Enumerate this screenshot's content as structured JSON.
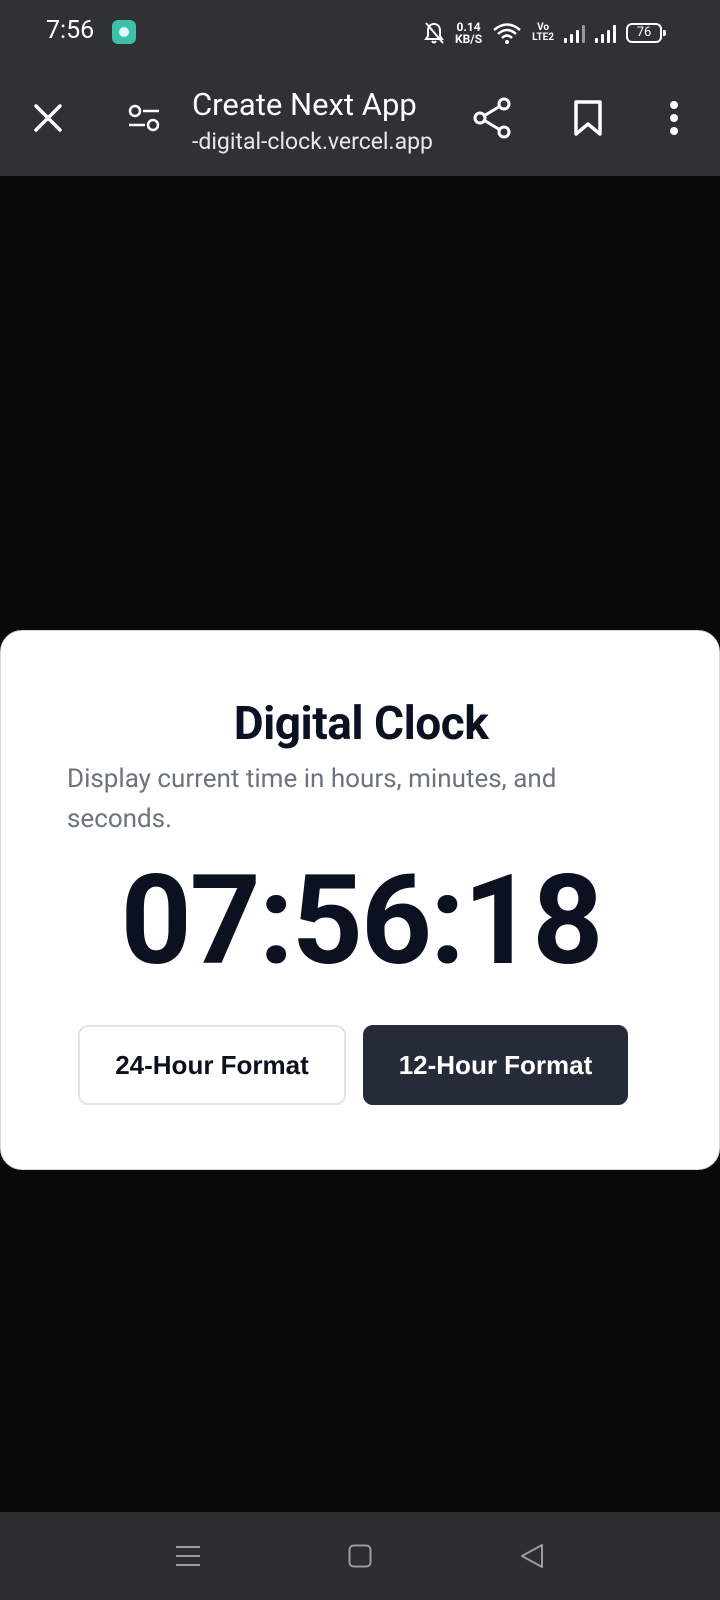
{
  "status_bar": {
    "time": "7:56",
    "net_speed_value": "0.14",
    "net_speed_unit": "KB/S",
    "volte_top": "Vo",
    "volte_bottom": "LTE2",
    "battery": "76"
  },
  "toolbar": {
    "page_title": "Create Next App",
    "url": "-digital-clock.vercel.app"
  },
  "card": {
    "title": "Digital Clock",
    "description": "Display current time in hours, minutes, and seconds.",
    "time": "07:56:18",
    "button_24h": "24-Hour Format",
    "button_12h": "12-Hour Format"
  },
  "colors": {
    "page_bg": "#0a0a0a",
    "bar_bg": "#303134",
    "primary_button": "#262b3a",
    "text_dark": "#0b1120",
    "text_muted": "#6b7280"
  }
}
